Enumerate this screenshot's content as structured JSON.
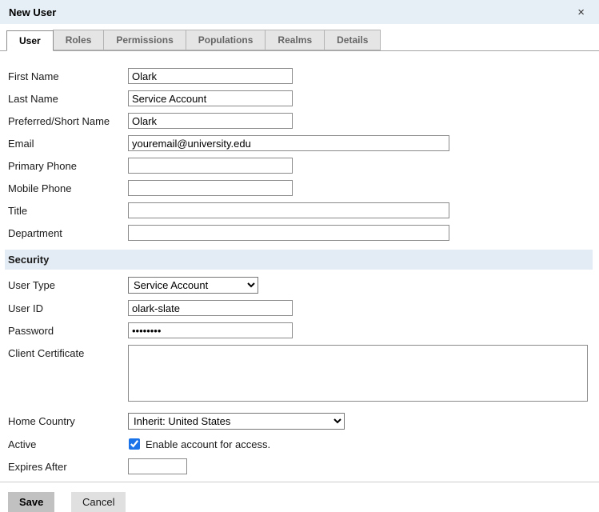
{
  "dialog": {
    "title": "New User",
    "close_icon": "×"
  },
  "tabs": {
    "active": "User",
    "items": [
      {
        "label": "User"
      },
      {
        "label": "Roles"
      },
      {
        "label": "Permissions"
      },
      {
        "label": "Populations"
      },
      {
        "label": "Realms"
      },
      {
        "label": "Details"
      }
    ]
  },
  "form": {
    "first_name": {
      "label": "First Name",
      "value": "Olark"
    },
    "last_name": {
      "label": "Last Name",
      "value": "Service Account"
    },
    "preferred_short_name": {
      "label": "Preferred/Short Name",
      "value": "Olark"
    },
    "email": {
      "label": "Email",
      "value": "youremail@university.edu"
    },
    "primary_phone": {
      "label": "Primary Phone",
      "value": ""
    },
    "mobile_phone": {
      "label": "Mobile Phone",
      "value": ""
    },
    "title": {
      "label": "Title",
      "value": ""
    },
    "department": {
      "label": "Department",
      "value": ""
    }
  },
  "security": {
    "heading": "Security",
    "user_type": {
      "label": "User Type",
      "value": "Service Account"
    },
    "user_id": {
      "label": "User ID",
      "value": "olark-slate"
    },
    "password": {
      "label": "Password",
      "value_masked": "••••••••"
    },
    "client_certificate": {
      "label": "Client Certificate",
      "value": ""
    },
    "home_country": {
      "label": "Home Country",
      "value": "Inherit: United States"
    },
    "active": {
      "label": "Active",
      "checkbox_label": "Enable account for access.",
      "checked": true
    },
    "expires_after": {
      "label": "Expires After",
      "value": ""
    }
  },
  "footer": {
    "save_label": "Save",
    "cancel_label": "Cancel"
  },
  "colors": {
    "header_bg": "#e7eff6",
    "section_bg": "#e3ecf4",
    "checkbox_accent": "#1a73e8",
    "save_bg": "#c1c1c1",
    "cancel_bg": "#e0e0e0"
  }
}
